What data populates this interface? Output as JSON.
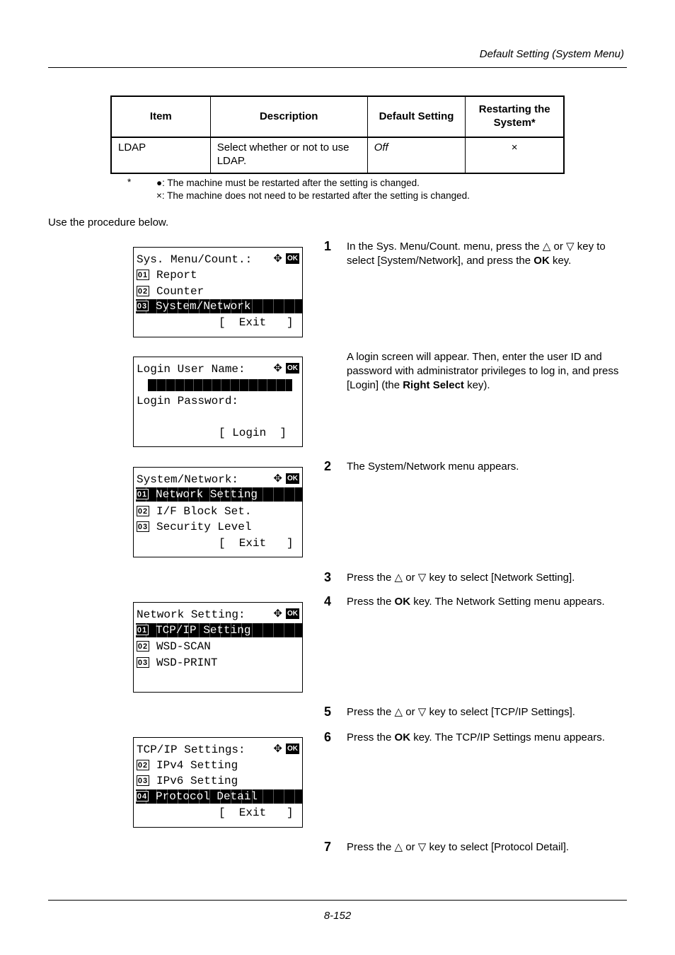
{
  "header": {
    "title": "Default Setting (System Menu)"
  },
  "table": {
    "headers": [
      "Item",
      "Description",
      "Default Setting",
      "Restarting the System*"
    ],
    "rows": [
      {
        "item": "LDAP",
        "description": "Select whether or not to use LDAP.",
        "default": "Off",
        "restart": "×"
      }
    ]
  },
  "footnote": {
    "asterisk": "*",
    "line1_symbol": "●",
    "line1": ": The machine must be restarted after the setting is changed.",
    "line2_symbol": "×",
    "line2": ": The machine does not need to be restarted after the setting is changed."
  },
  "intro": "Use the procedure below.",
  "screens": [
    {
      "title": "Sys. Menu/Count.:",
      "items": [
        {
          "num": "01",
          "label": "Report",
          "selected": false
        },
        {
          "num": "02",
          "label": "Counter",
          "selected": false
        },
        {
          "num": "03",
          "label": "System/Network",
          "selected": true
        }
      ],
      "softkey": "[  Exit   ]"
    },
    {
      "title": "Login User Name:",
      "label2": "Login Password:",
      "softkey": "[ Login  ]"
    },
    {
      "title": "System/Network:",
      "items": [
        {
          "num": "01",
          "label": "Network Setting",
          "selected": true
        },
        {
          "num": "02",
          "label": "I/F Block Set.",
          "selected": false
        },
        {
          "num": "03",
          "label": "Security Level",
          "selected": false
        }
      ],
      "softkey": "[  Exit   ]"
    },
    {
      "title": "Network Setting:",
      "items": [
        {
          "num": "01",
          "label": "TCP/IP Setting",
          "selected": true
        },
        {
          "num": "02",
          "label": "WSD-SCAN",
          "selected": false
        },
        {
          "num": "03",
          "label": "WSD-PRINT",
          "selected": false
        }
      ]
    },
    {
      "title": "TCP/IP Settings:",
      "items": [
        {
          "num": "02",
          "label": "IPv4 Setting",
          "selected": false
        },
        {
          "num": "03",
          "label": "IPv6 Setting",
          "selected": false
        },
        {
          "num": "04",
          "label": "Protocol Detail",
          "selected": true
        }
      ],
      "softkey": "[  Exit   ]"
    }
  ],
  "lcd_icons": {
    "arrows": "✥",
    "ok": "OK"
  },
  "steps": [
    {
      "num": "1",
      "parts": [
        "In the Sys. Menu/Count. menu, press the △ or ▽ key to select [System/Network], and press the ",
        "OK",
        " key."
      ]
    },
    {
      "num": "",
      "parts": [
        "A login screen will appear. Then, enter the user ID and password with administrator privileges to log in, and press [Login] (the ",
        "Right Select",
        " key)."
      ]
    },
    {
      "num": "2",
      "parts": [
        "The System/Network menu appears.",
        "",
        ""
      ]
    },
    {
      "num": "3",
      "parts": [
        "Press the △ or ▽ key to select [Network Setting].",
        "",
        ""
      ]
    },
    {
      "num": "4",
      "parts": [
        "Press the ",
        "OK",
        " key. The Network Setting menu appears."
      ]
    },
    {
      "num": "5",
      "parts": [
        "Press the △ or ▽ key to select [TCP/IP Settings].",
        "",
        ""
      ]
    },
    {
      "num": "6",
      "parts": [
        "Press the ",
        "OK",
        " key. The TCP/IP Settings menu appears."
      ]
    },
    {
      "num": "7",
      "parts": [
        "Press the △ or ▽ key to select [Protocol Detail].",
        "",
        ""
      ]
    }
  ],
  "footer": {
    "page": "8-152"
  }
}
